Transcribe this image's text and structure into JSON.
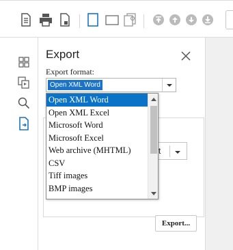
{
  "panel": {
    "title": "Export",
    "format_label": "Export format:",
    "selected_format": "Open XML Word",
    "export_button": "Export...",
    "inner_select_value": "t"
  },
  "dropdown": {
    "items": [
      "Open XML Word",
      "Open XML Excel",
      "Microsoft Word",
      "Microsoft Excel",
      "Web archive (MHTML)",
      "CSV",
      "Tiff images",
      "BMP images"
    ],
    "selected_index": 0
  },
  "toolbar": {
    "icons": [
      "document-icon",
      "print-icon",
      "page-setup-icon",
      "single-page-icon",
      "two-page-icon",
      "multipage-icon",
      "first-page-icon",
      "previous-page-icon",
      "next-page-icon",
      "last-page-icon"
    ]
  },
  "rail": {
    "icons": [
      "thumbnails-icon",
      "bookmarks-icon",
      "search-icon",
      "export-icon"
    ]
  },
  "colors": {
    "accent": "#0a73c8",
    "icon_dark": "#555555",
    "icon_blue": "#1a73c7",
    "icon_disabled": "#b9b9b9"
  }
}
